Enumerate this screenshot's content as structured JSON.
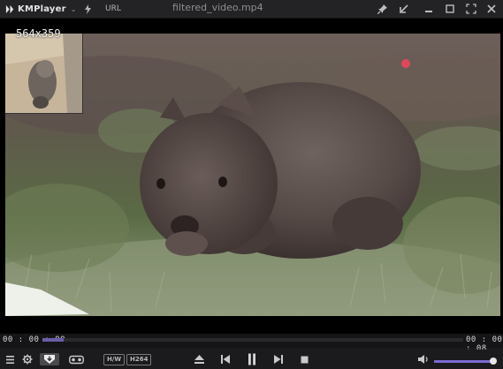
{
  "app": {
    "name": "KMPlayer",
    "file_title": "filtered_video.mp4"
  },
  "toolbar": {
    "url_label": "URL"
  },
  "video": {
    "resolution_label": "564x359"
  },
  "playback": {
    "current_time": "00 : 00 : 00",
    "total_time": "00 : 00 : 08",
    "progress": 0.05
  },
  "badges": {
    "hw": "H/W",
    "codec": "H264"
  },
  "volume": {
    "level": 0.98
  },
  "colors": {
    "accent": "#7b6ad1",
    "background": "#1b1b1d"
  }
}
